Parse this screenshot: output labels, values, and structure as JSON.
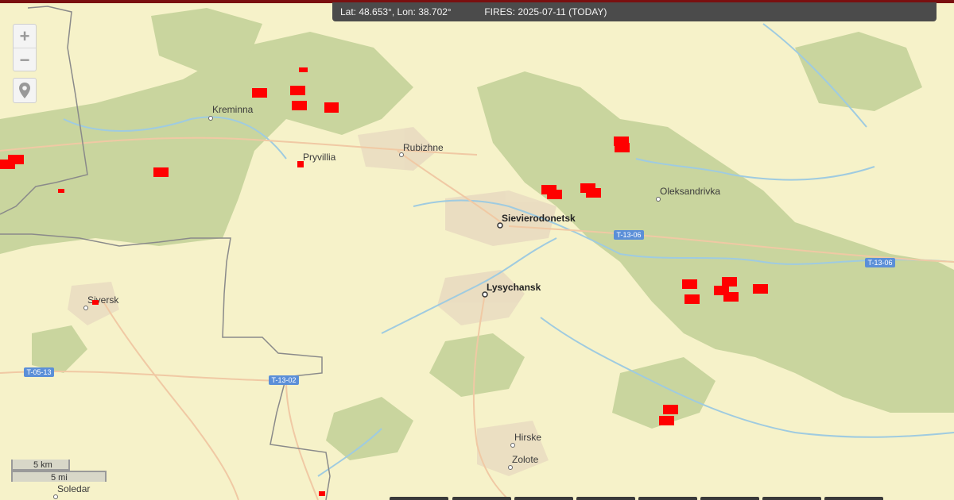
{
  "status_bar": {
    "coordinates": "Lat: 48.653°, Lon: 38.702°",
    "fires_label": "FIRES: 2025-07-11 (TODAY)"
  },
  "controls": {
    "zoom_in": "+",
    "zoom_out": "−"
  },
  "scale": {
    "metric": "5 km",
    "imperial": "5 mi"
  },
  "places": {
    "kreminna": "Kreminna",
    "rubizhne": "Rubizhne",
    "pryvillia": "Pryvillia",
    "sievierodonetsk": "Sievierodonetsk",
    "oleksandrivka": "Oleksandrivka",
    "lysychansk": "Lysychansk",
    "siversk": "Siversk",
    "hirske": "Hirske",
    "zolote": "Zolote",
    "soledar": "Soledar"
  },
  "roads": {
    "t1306_a": "T-13-06",
    "t1306_b": "T-13-06",
    "t0513": "T-05-13",
    "t1302": "T-13-02"
  },
  "colors": {
    "fire": "#ff0000",
    "forest": "#c9d59e",
    "land": "#f6f2c9",
    "river": "#9fcbe0",
    "road": "#f0c9a4",
    "border": "#8a8a8a"
  }
}
